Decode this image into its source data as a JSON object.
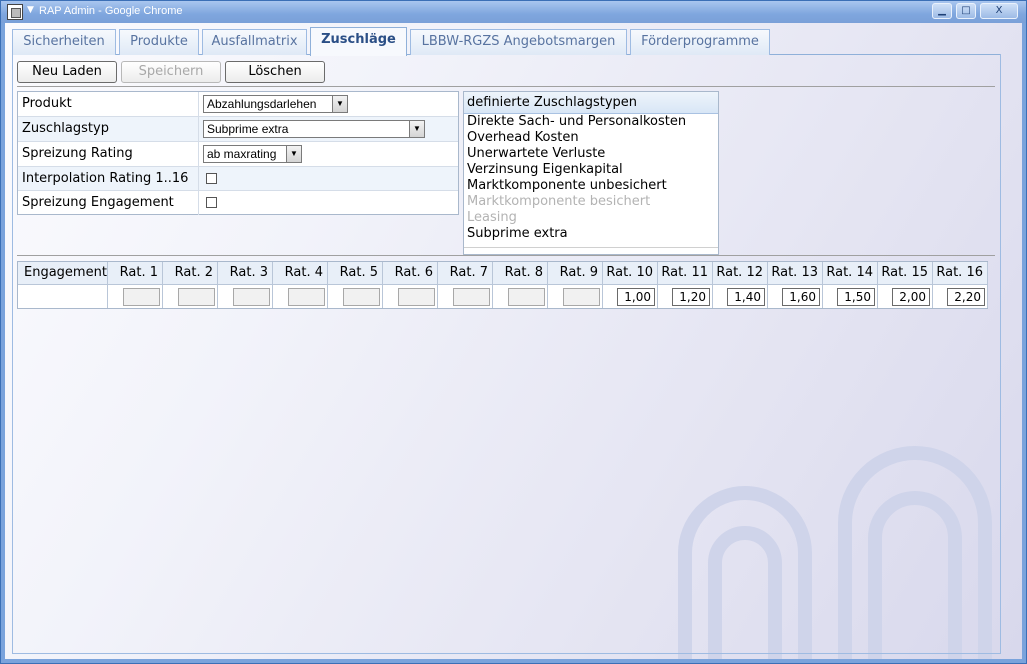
{
  "window": {
    "title": "RAP Admin - Google Chrome",
    "minimize_glyph": "▁",
    "maximize_glyph": "□",
    "close_glyph": "X"
  },
  "tabs": [
    {
      "label": "Sicherheiten",
      "active": false
    },
    {
      "label": "Produkte",
      "active": false
    },
    {
      "label": "Ausfallmatrix",
      "active": false
    },
    {
      "label": "Zuschläge",
      "active": true
    },
    {
      "label": "LBBW-RGZS Angebotsmargen",
      "active": false
    },
    {
      "label": "Förderprogramme",
      "active": false
    }
  ],
  "toolbar": {
    "reload_label": "Neu Laden",
    "save_label": "Speichern",
    "delete_label": "Löschen"
  },
  "form": {
    "produkt_label": "Produkt",
    "produkt_value": "Abzahlungsdarlehen",
    "zuschlagstyp_label": "Zuschlagstyp",
    "zuschlagstyp_value": "Subprime extra",
    "spreizung_rating_label": "Spreizung Rating",
    "spreizung_rating_value": "ab maxrating",
    "interpolation_label": "Interpolation Rating 1..16",
    "spreizung_engagement_label": "Spreizung Engagement"
  },
  "zuschlagstypen": {
    "header": "definierte Zuschlagstypen",
    "items": [
      {
        "label": "Direkte Sach- und Personalkosten",
        "dim": false
      },
      {
        "label": "Overhead Kosten",
        "dim": false
      },
      {
        "label": "Unerwartete Verluste",
        "dim": false
      },
      {
        "label": "Verzinsung Eigenkapital",
        "dim": false
      },
      {
        "label": "Marktkomponente unbesichert",
        "dim": false
      },
      {
        "label": "Marktkomponente besichert",
        "dim": true
      },
      {
        "label": "Leasing",
        "dim": true
      },
      {
        "label": "Subprime extra",
        "dim": false
      }
    ]
  },
  "grid": {
    "first_header": "Engagement",
    "headers": [
      "Rat. 1",
      "Rat. 2",
      "Rat. 3",
      "Rat. 4",
      "Rat. 5",
      "Rat. 6",
      "Rat. 7",
      "Rat. 8",
      "Rat. 9",
      "Rat. 10",
      "Rat. 11",
      "Rat. 12",
      "Rat. 13",
      "Rat. 14",
      "Rat. 15",
      "Rat. 16"
    ],
    "values": [
      "",
      "",
      "",
      "",
      "",
      "",
      "",
      "",
      "",
      "1,00",
      "1,20",
      "1,40",
      "1,60",
      "1,50",
      "2,00",
      "2,20"
    ]
  }
}
